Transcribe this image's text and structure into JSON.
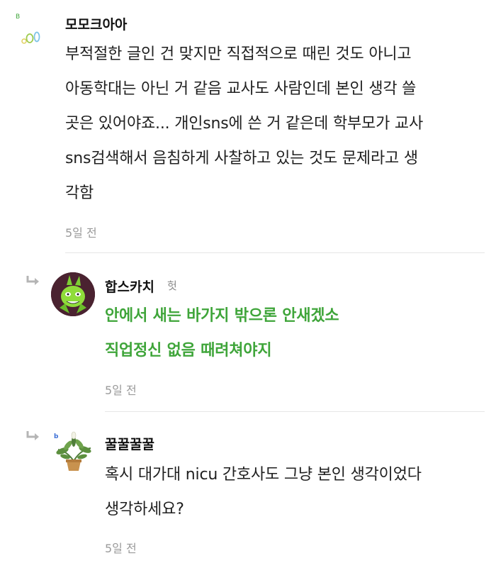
{
  "comments": [
    {
      "username": "모모크아아",
      "lines": [
        "부적절한 글인 건 맞지만 직접적으로 때린 것도 아니고",
        "아동학대는 아닌 거 같음 교사도 사람인데 본인 생각 쓸",
        "곳은 있어야죠... 개인sns에 쓴 거 같은데 학부모가 교사",
        "sns검색해서 음침하게 사찰하고 있는 것도 문제라고 생",
        "각함"
      ],
      "time": "5일 전"
    },
    {
      "username": "합스카치",
      "badge": "헛",
      "lines": [
        "안에서 새는 바가지 밖으론 안새겠소",
        "직업정신 없음 때려쳐야지"
      ],
      "time": "5일 전"
    },
    {
      "username": "꿀꿀꿀꿀",
      "lines": [
        "혹시 대가대 nicu 간호사도 그냥 본인 생각이었다",
        "생각하세요?"
      ],
      "time": "5일 전"
    }
  ],
  "colors": {
    "reply_text": "#3fa53a",
    "timestamp": "#9a9a9a",
    "divider": "#e6e6e6"
  },
  "icons": [
    "bubbles-avatar-icon",
    "reply-arrow-icon",
    "green-character-avatar",
    "plant-avatar-icon"
  ]
}
